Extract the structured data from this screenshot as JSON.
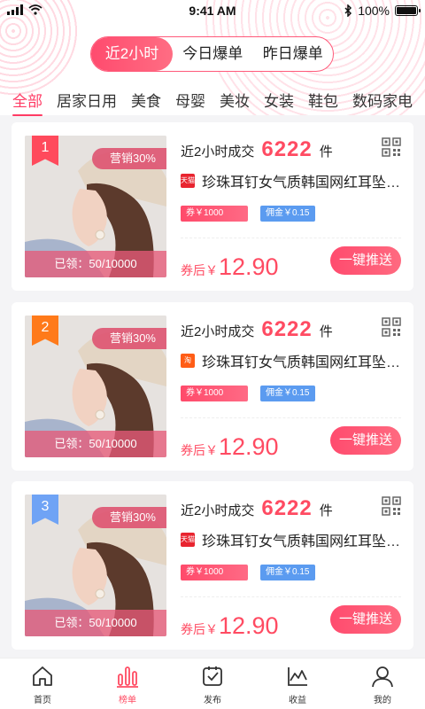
{
  "status_bar": {
    "time": "9:41 AM",
    "battery": "100%"
  },
  "tabs": [
    {
      "label": "近2小时",
      "active": true
    },
    {
      "label": "今日爆单",
      "active": false
    },
    {
      "label": "昨日爆单",
      "active": false
    }
  ],
  "categories": [
    "全部",
    "居家日用",
    "美食",
    "母婴",
    "美妆",
    "女装",
    "鞋包",
    "数码家电"
  ],
  "active_category": "全部",
  "products": [
    {
      "rank": "1",
      "rank_color": "#ff4a5c",
      "promo": "营销30%",
      "claimed": "已领：50/10000",
      "sales_prefix": "近2小时成交",
      "sales_count": "6222",
      "sales_unit": "件",
      "shop_icon": "tmall-icon",
      "shop_badge": "天猫",
      "title": "珍珠耳钉女气质韩国网红耳坠…",
      "coupon": "券￥1000",
      "commission": "佣金￥0.15",
      "price_label": "券后￥",
      "price": "12.90",
      "push_label": "一键推送"
    },
    {
      "rank": "2",
      "rank_color": "#ff7a1a",
      "promo": "营销30%",
      "claimed": "已领：50/10000",
      "sales_prefix": "近2小时成交",
      "sales_count": "6222",
      "sales_unit": "件",
      "shop_icon": "taobao-icon",
      "shop_badge": "淘",
      "title": "珍珠耳钉女气质韩国网红耳坠…",
      "coupon": "券￥1000",
      "commission": "佣金￥0.15",
      "price_label": "券后￥",
      "price": "12.90",
      "push_label": "一键推送"
    },
    {
      "rank": "3",
      "rank_color": "#6fa3f5",
      "promo": "营销30%",
      "claimed": "已领：50/10000",
      "sales_prefix": "近2小时成交",
      "sales_count": "6222",
      "sales_unit": "件",
      "shop_icon": "tmall-icon",
      "shop_badge": "天猫",
      "title": "珍珠耳钉女气质韩国网红耳坠…",
      "coupon": "券￥1000",
      "commission": "佣金￥0.15",
      "price_label": "券后￥",
      "price": "12.90",
      "push_label": "一键推送"
    }
  ],
  "bottom_nav": [
    {
      "label": "首页",
      "icon": "home-icon",
      "active": false
    },
    {
      "label": "榜单",
      "icon": "ranking-icon",
      "active": true
    },
    {
      "label": "发布",
      "icon": "publish-icon",
      "active": false
    },
    {
      "label": "收益",
      "icon": "earnings-icon",
      "active": false
    },
    {
      "label": "我的",
      "icon": "profile-icon",
      "active": false
    }
  ],
  "colors": {
    "accent": "#ff4b6e",
    "price": "#ff4b62",
    "commission": "#5b9bf0"
  }
}
